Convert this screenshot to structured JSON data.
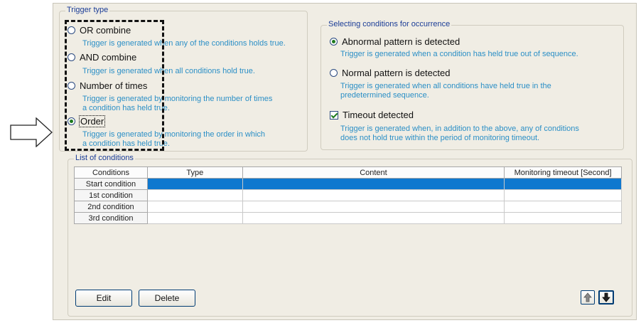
{
  "trigger_type": {
    "title": "Trigger type",
    "options": [
      {
        "label": "OR combine",
        "desc": [
          "Trigger is generated when any of the conditions holds true."
        ],
        "selected": false
      },
      {
        "label": "AND combine",
        "desc": [
          "Trigger is generated when all conditions hold true."
        ],
        "selected": false
      },
      {
        "label": "Number of times",
        "desc": [
          "Trigger is generated by monitoring the number of times",
          "a condition has held true."
        ],
        "selected": false
      },
      {
        "label": "Order",
        "desc": [
          "Trigger is generated by monitoring the order in which",
          "a condition has held true."
        ],
        "selected": true
      }
    ]
  },
  "occurrence": {
    "title": "Selecting conditions for occurrence",
    "options": [
      {
        "label": "Abnormal pattern is detected",
        "desc": [
          "Trigger is generated when a condition has held true out of sequence."
        ],
        "selected": true
      },
      {
        "label": "Normal pattern is detected",
        "desc": [
          "Trigger is generated when all conditions have held true in the",
          "predetermined sequence."
        ],
        "selected": false
      }
    ],
    "timeout": {
      "label": "Timeout detected",
      "desc": [
        "Trigger is generated when, in addition to the above, any of conditions",
        "does not hold true within the period of monitoring timeout."
      ],
      "checked": true
    }
  },
  "conditions": {
    "title": "List of conditions",
    "columns": [
      "Conditions",
      "Type",
      "Content",
      "Monitoring timeout [Second]"
    ],
    "rows": [
      {
        "name": "Start condition",
        "type": "",
        "content": "",
        "timeout": "",
        "selected": true
      },
      {
        "name": "1st condition",
        "type": "",
        "content": "",
        "timeout": "",
        "selected": false
      },
      {
        "name": "2nd condition",
        "type": "",
        "content": "",
        "timeout": "",
        "selected": false
      },
      {
        "name": "3rd condition",
        "type": "",
        "content": "",
        "timeout": "",
        "selected": false
      }
    ],
    "edit_label": "Edit",
    "delete_label": "Delete",
    "up_icon": "arrow-up-icon",
    "down_icon": "arrow-down-icon"
  },
  "colors": {
    "accent": "#2b8fc6",
    "selection": "#0f78cf",
    "title": "#1a3c96"
  }
}
